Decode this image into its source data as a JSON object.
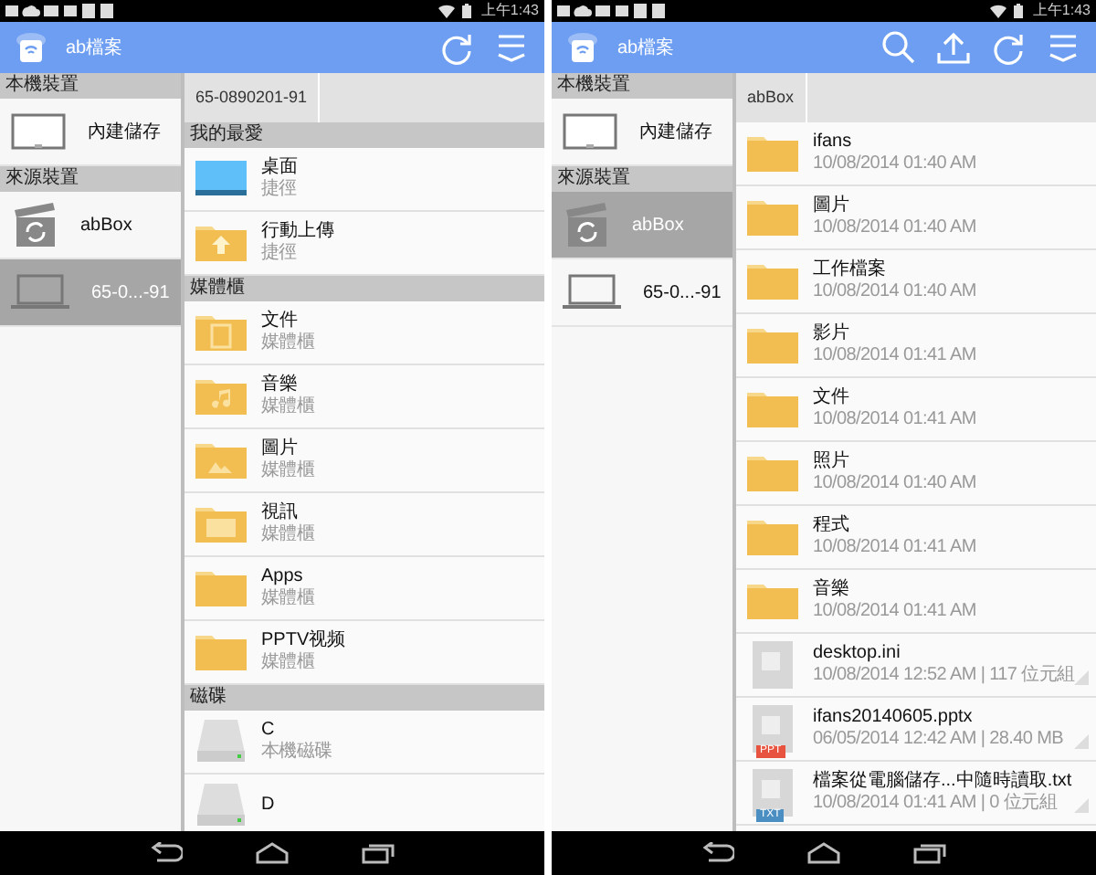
{
  "screens": [
    {
      "status": {
        "time": "上午1:43"
      },
      "app_bar": {
        "title": "ab檔案",
        "actions": [
          {
            "kind": "refresh"
          },
          {
            "kind": "menu"
          }
        ]
      },
      "sidebar": [
        {
          "kind": "header",
          "label": "本機裝置"
        },
        {
          "kind": "tablet",
          "label": "內建儲存",
          "selected": false
        },
        {
          "kind": "header",
          "label": "來源裝置"
        },
        {
          "kind": "box",
          "label": "abBox",
          "selected": false
        },
        {
          "kind": "laptop",
          "label": "65-0...-91",
          "selected": true
        }
      ],
      "breadcrumb": "65-0890201-91",
      "list": [
        {
          "kind": "header",
          "label": "我的最愛"
        },
        {
          "kind": "desktop",
          "name": "桌面",
          "detail": "捷徑"
        },
        {
          "kind": "folder-upload",
          "name": "行動上傳",
          "detail": "捷徑"
        },
        {
          "kind": "header",
          "label": "媒體櫃"
        },
        {
          "kind": "folder-doc",
          "name": "文件",
          "detail": "媒體櫃"
        },
        {
          "kind": "folder-music",
          "name": "音樂",
          "detail": "媒體櫃"
        },
        {
          "kind": "folder-image",
          "name": "圖片",
          "detail": "媒體櫃"
        },
        {
          "kind": "folder-video",
          "name": "視訊",
          "detail": "媒體櫃"
        },
        {
          "kind": "folder",
          "name": "Apps",
          "detail": "媒體櫃"
        },
        {
          "kind": "folder",
          "name": "PPTV视频",
          "detail": "媒體櫃"
        },
        {
          "kind": "header",
          "label": "磁碟"
        },
        {
          "kind": "drive",
          "name": "C",
          "detail": "本機磁碟"
        },
        {
          "kind": "drive",
          "name": "D"
        }
      ]
    },
    {
      "status": {
        "time": "上午1:43"
      },
      "app_bar": {
        "title": "ab檔案",
        "actions": [
          {
            "kind": "search"
          },
          {
            "kind": "upload"
          },
          {
            "kind": "refresh"
          },
          {
            "kind": "menu"
          }
        ]
      },
      "sidebar": [
        {
          "kind": "header",
          "label": "本機裝置"
        },
        {
          "kind": "tablet",
          "label": "內建儲存",
          "selected": false
        },
        {
          "kind": "header",
          "label": "來源裝置"
        },
        {
          "kind": "box",
          "label": "abBox",
          "selected": true
        },
        {
          "kind": "laptop",
          "label": "65-0...-91",
          "selected": false
        }
      ],
      "breadcrumb": "abBox",
      "list": [
        {
          "kind": "folder",
          "name": "ifans",
          "detail": "10/08/2014 01:40 AM"
        },
        {
          "kind": "folder",
          "name": "圖片",
          "detail": "10/08/2014 01:40 AM"
        },
        {
          "kind": "folder",
          "name": "工作檔案",
          "detail": "10/08/2014 01:40 AM"
        },
        {
          "kind": "folder",
          "name": "影片",
          "detail": "10/08/2014 01:41 AM"
        },
        {
          "kind": "folder",
          "name": "文件",
          "detail": "10/08/2014 01:41 AM"
        },
        {
          "kind": "folder",
          "name": "照片",
          "detail": "10/08/2014 01:40 AM"
        },
        {
          "kind": "folder",
          "name": "程式",
          "detail": "10/08/2014 01:41 AM"
        },
        {
          "kind": "folder",
          "name": "音樂",
          "detail": "10/08/2014 01:41 AM"
        },
        {
          "kind": "file",
          "name": "desktop.ini",
          "detail": "10/08/2014 12:52 AM | 117 位元組"
        },
        {
          "kind": "file",
          "name": "ifans20140605.pptx",
          "detail": "06/05/2014 12:42 AM | 28.40 MB",
          "badge": {
            "text": "PPT",
            "color": "#e8533f"
          }
        },
        {
          "kind": "file",
          "name": "檔案從電腦儲存...中隨時讀取.txt",
          "detail": "10/08/2014 01:41 AM | 0 位元組",
          "badge": {
            "text": "TXT",
            "color": "#4a8ec2"
          }
        }
      ]
    }
  ]
}
